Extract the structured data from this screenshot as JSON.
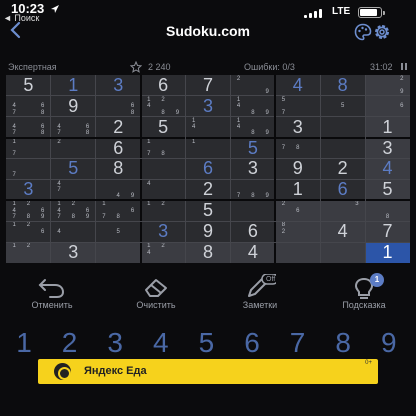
{
  "status": {
    "time": "10:23",
    "back_app": "◄ Поиск",
    "network": "LTE"
  },
  "nav": {
    "title": "Sudoku.com"
  },
  "info": {
    "difficulty": "Экспертная",
    "score": "2 240",
    "mistakes": "Ошибки: 0/3",
    "timer": "31:02"
  },
  "grid": [
    [
      {
        "v": "5",
        "s": "given"
      },
      {
        "v": "1",
        "s": "user"
      },
      {
        "v": "3",
        "s": "user"
      },
      {
        "v": "6",
        "s": "given"
      },
      {
        "v": "7",
        "s": "given"
      },
      {
        "n": [
          "2",
          "",
          "",
          "",
          "",
          "",
          "",
          "",
          "9"
        ]
      },
      {
        "v": "4",
        "s": "user"
      },
      {
        "v": "8",
        "s": "user"
      },
      {
        "n": [
          "",
          "",
          "2",
          "",
          "",
          "",
          "",
          "",
          "9"
        ]
      }
    ],
    [
      {
        "n": [
          "",
          "",
          "",
          "4",
          "",
          "6",
          "7",
          "",
          "8"
        ]
      },
      {
        "v": "9",
        "s": "given"
      },
      {
        "n": [
          "",
          "",
          "",
          "",
          "",
          "6",
          "",
          "",
          "8"
        ]
      },
      {
        "n": [
          "1",
          "2",
          "",
          "4",
          "",
          "",
          "",
          "8",
          "9"
        ]
      },
      {
        "v": "3",
        "s": "user"
      },
      {
        "n": [
          "1",
          "",
          "",
          "4",
          "",
          "",
          "",
          "8",
          "9"
        ]
      },
      {
        "n": [
          "5",
          "",
          "",
          "",
          "",
          "",
          "7",
          "",
          ""
        ]
      },
      {
        "n": [
          "",
          "",
          "",
          "",
          "5",
          "",
          "",
          "",
          ""
        ]
      },
      {
        "n": [
          "",
          "",
          "",
          "",
          "",
          "6",
          "",
          "",
          ""
        ]
      }
    ],
    [
      {
        "n": [
          "",
          "",
          "",
          "4",
          "",
          "6",
          "7",
          "",
          "8"
        ]
      },
      {
        "n": [
          "",
          "",
          "",
          "4",
          "",
          "6",
          "7",
          "",
          "8"
        ]
      },
      {
        "v": "2",
        "s": "given"
      },
      {
        "v": "5",
        "s": "given"
      },
      {
        "n": [
          "1",
          "",
          "",
          "4",
          "",
          "",
          "",
          "",
          ""
        ]
      },
      {
        "n": [
          "1",
          "",
          "",
          "4",
          "",
          "",
          "",
          "8",
          "9"
        ]
      },
      {
        "v": "3",
        "s": "given"
      },
      {
        "n": [
          "",
          "",
          "",
          "",
          "",
          "",
          "",
          "",
          ""
        ]
      },
      {
        "v": "1",
        "s": "given"
      }
    ],
    [
      {
        "n": [
          "1",
          "",
          "",
          "",
          "",
          "",
          "7",
          "",
          ""
        ]
      },
      {
        "n": [
          "2",
          "",
          "",
          "",
          "",
          "",
          "",
          "",
          ""
        ]
      },
      {
        "v": "6",
        "s": "given"
      },
      {
        "n": [
          "1",
          "",
          "",
          "",
          "",
          "",
          "7",
          "8",
          ""
        ]
      },
      {
        "n": [
          "1",
          "",
          "",
          "",
          "",
          "",
          "",
          "",
          ""
        ]
      },
      {
        "v": "5",
        "s": "user"
      },
      {
        "n": [
          "",
          "",
          "",
          "7",
          "8",
          "",
          "",
          "",
          ""
        ]
      },
      {
        "n": [
          "",
          "",
          "",
          "",
          "",
          "",
          "",
          "",
          ""
        ]
      },
      {
        "v": "3",
        "s": "given"
      }
    ],
    [
      {
        "n": [
          "",
          "",
          "",
          "",
          "",
          "",
          "7",
          "",
          ""
        ]
      },
      {
        "v": "5",
        "s": "user"
      },
      {
        "v": "8",
        "s": "given"
      },
      {
        "n": [
          "",
          "",
          "",
          "",
          "",
          "",
          "",
          "",
          ""
        ]
      },
      {
        "v": "6",
        "s": "user"
      },
      {
        "v": "3",
        "s": "given"
      },
      {
        "v": "9",
        "s": "given"
      },
      {
        "v": "2",
        "s": "given"
      },
      {
        "v": "4",
        "s": "user"
      }
    ],
    [
      {
        "v": "3",
        "s": "user"
      },
      {
        "n": [
          "4",
          "",
          "",
          "7",
          "",
          "",
          "",
          "",
          ""
        ]
      },
      {
        "n": [
          "",
          "",
          "",
          "",
          "",
          "",
          "",
          "4",
          "9"
        ]
      },
      {
        "n": [
          "4",
          "",
          "",
          "",
          "",
          "",
          "",
          "",
          ""
        ]
      },
      {
        "v": "2",
        "s": "given"
      },
      {
        "n": [
          "",
          "",
          "",
          "",
          "",
          "",
          "7",
          "8",
          "9"
        ]
      },
      {
        "v": "1",
        "s": "given"
      },
      {
        "v": "6",
        "s": "user"
      },
      {
        "v": "5",
        "s": "given"
      }
    ],
    [
      {
        "n": [
          "1",
          "2",
          "",
          "4",
          "",
          "6",
          "7",
          "8",
          "9"
        ]
      },
      {
        "n": [
          "1",
          "2",
          "",
          "4",
          "",
          "6",
          "7",
          "8",
          "9"
        ]
      },
      {
        "n": [
          "1",
          "",
          "",
          "",
          "",
          "6",
          "7",
          "8",
          ""
        ]
      },
      {
        "n": [
          "1",
          "2",
          "",
          "",
          "",
          "",
          "",
          "",
          ""
        ]
      },
      {
        "v": "5",
        "s": "given"
      },
      {
        "n": [
          "",
          "",
          "",
          "",
          "",
          "",
          "",
          "",
          ""
        ]
      },
      {
        "n": [
          "2",
          "",
          "",
          "",
          "6",
          "",
          "",
          "",
          ""
        ]
      },
      {
        "n": [
          "",
          "",
          "3",
          "",
          "",
          "",
          "",
          "",
          ""
        ]
      },
      {
        "n": [
          "",
          "",
          "",
          "",
          "",
          "",
          "",
          "8",
          ""
        ]
      }
    ],
    [
      {
        "n": [
          "1",
          "2",
          "",
          "",
          "",
          "6",
          "",
          "",
          ""
        ]
      },
      {
        "n": [
          "",
          "",
          "",
          "4",
          "",
          "",
          "",
          "",
          ""
        ]
      },
      {
        "n": [
          "",
          "",
          "",
          "",
          "5",
          "",
          "",
          "",
          ""
        ]
      },
      {
        "v": "3",
        "s": "user"
      },
      {
        "v": "9",
        "s": "given"
      },
      {
        "v": "6",
        "s": "given"
      },
      {
        "n": [
          "8",
          "",
          "",
          "2",
          "",
          "",
          "",
          "",
          ""
        ]
      },
      {
        "v": "4",
        "s": "given"
      },
      {
        "v": "7",
        "s": "given"
      }
    ],
    [
      {
        "n": [
          "1",
          "2",
          "",
          "",
          "",
          "",
          "",
          "",
          ""
        ]
      },
      {
        "v": "3",
        "s": "given"
      },
      {
        "n": [
          "",
          "",
          "",
          "",
          "",
          "",
          "",
          "",
          ""
        ]
      },
      {
        "n": [
          "1",
          "2",
          "",
          "4",
          "",
          "",
          "",
          "",
          ""
        ]
      },
      {
        "v": "8",
        "s": "given"
      },
      {
        "v": "4",
        "s": "given"
      },
      {
        "n": [
          "",
          "",
          "",
          "",
          "",
          "",
          "",
          "",
          ""
        ]
      },
      {
        "n": [
          "",
          "",
          "",
          "",
          "",
          "",
          "",
          "",
          ""
        ]
      },
      {
        "v": "1",
        "s": "selected"
      }
    ]
  ],
  "colors": {
    "given": "#cfd2d8",
    "user": "#5c7cc4",
    "selected_bg": "#2c55a8",
    "highlight_bg": "#3b3c42"
  },
  "tools": [
    {
      "label": "Отменить",
      "icon": "undo-icon"
    },
    {
      "label": "Очистить",
      "icon": "eraser-icon"
    },
    {
      "label": "Заметки",
      "icon": "pencil-icon",
      "badge": "Off"
    },
    {
      "label": "Подсказка",
      "icon": "hint-icon",
      "badge": "1"
    }
  ],
  "numpad": [
    "1",
    "2",
    "3",
    "4",
    "5",
    "6",
    "7",
    "8",
    "9"
  ],
  "ad": {
    "text": "Яндекс Еда",
    "age": "0+"
  }
}
